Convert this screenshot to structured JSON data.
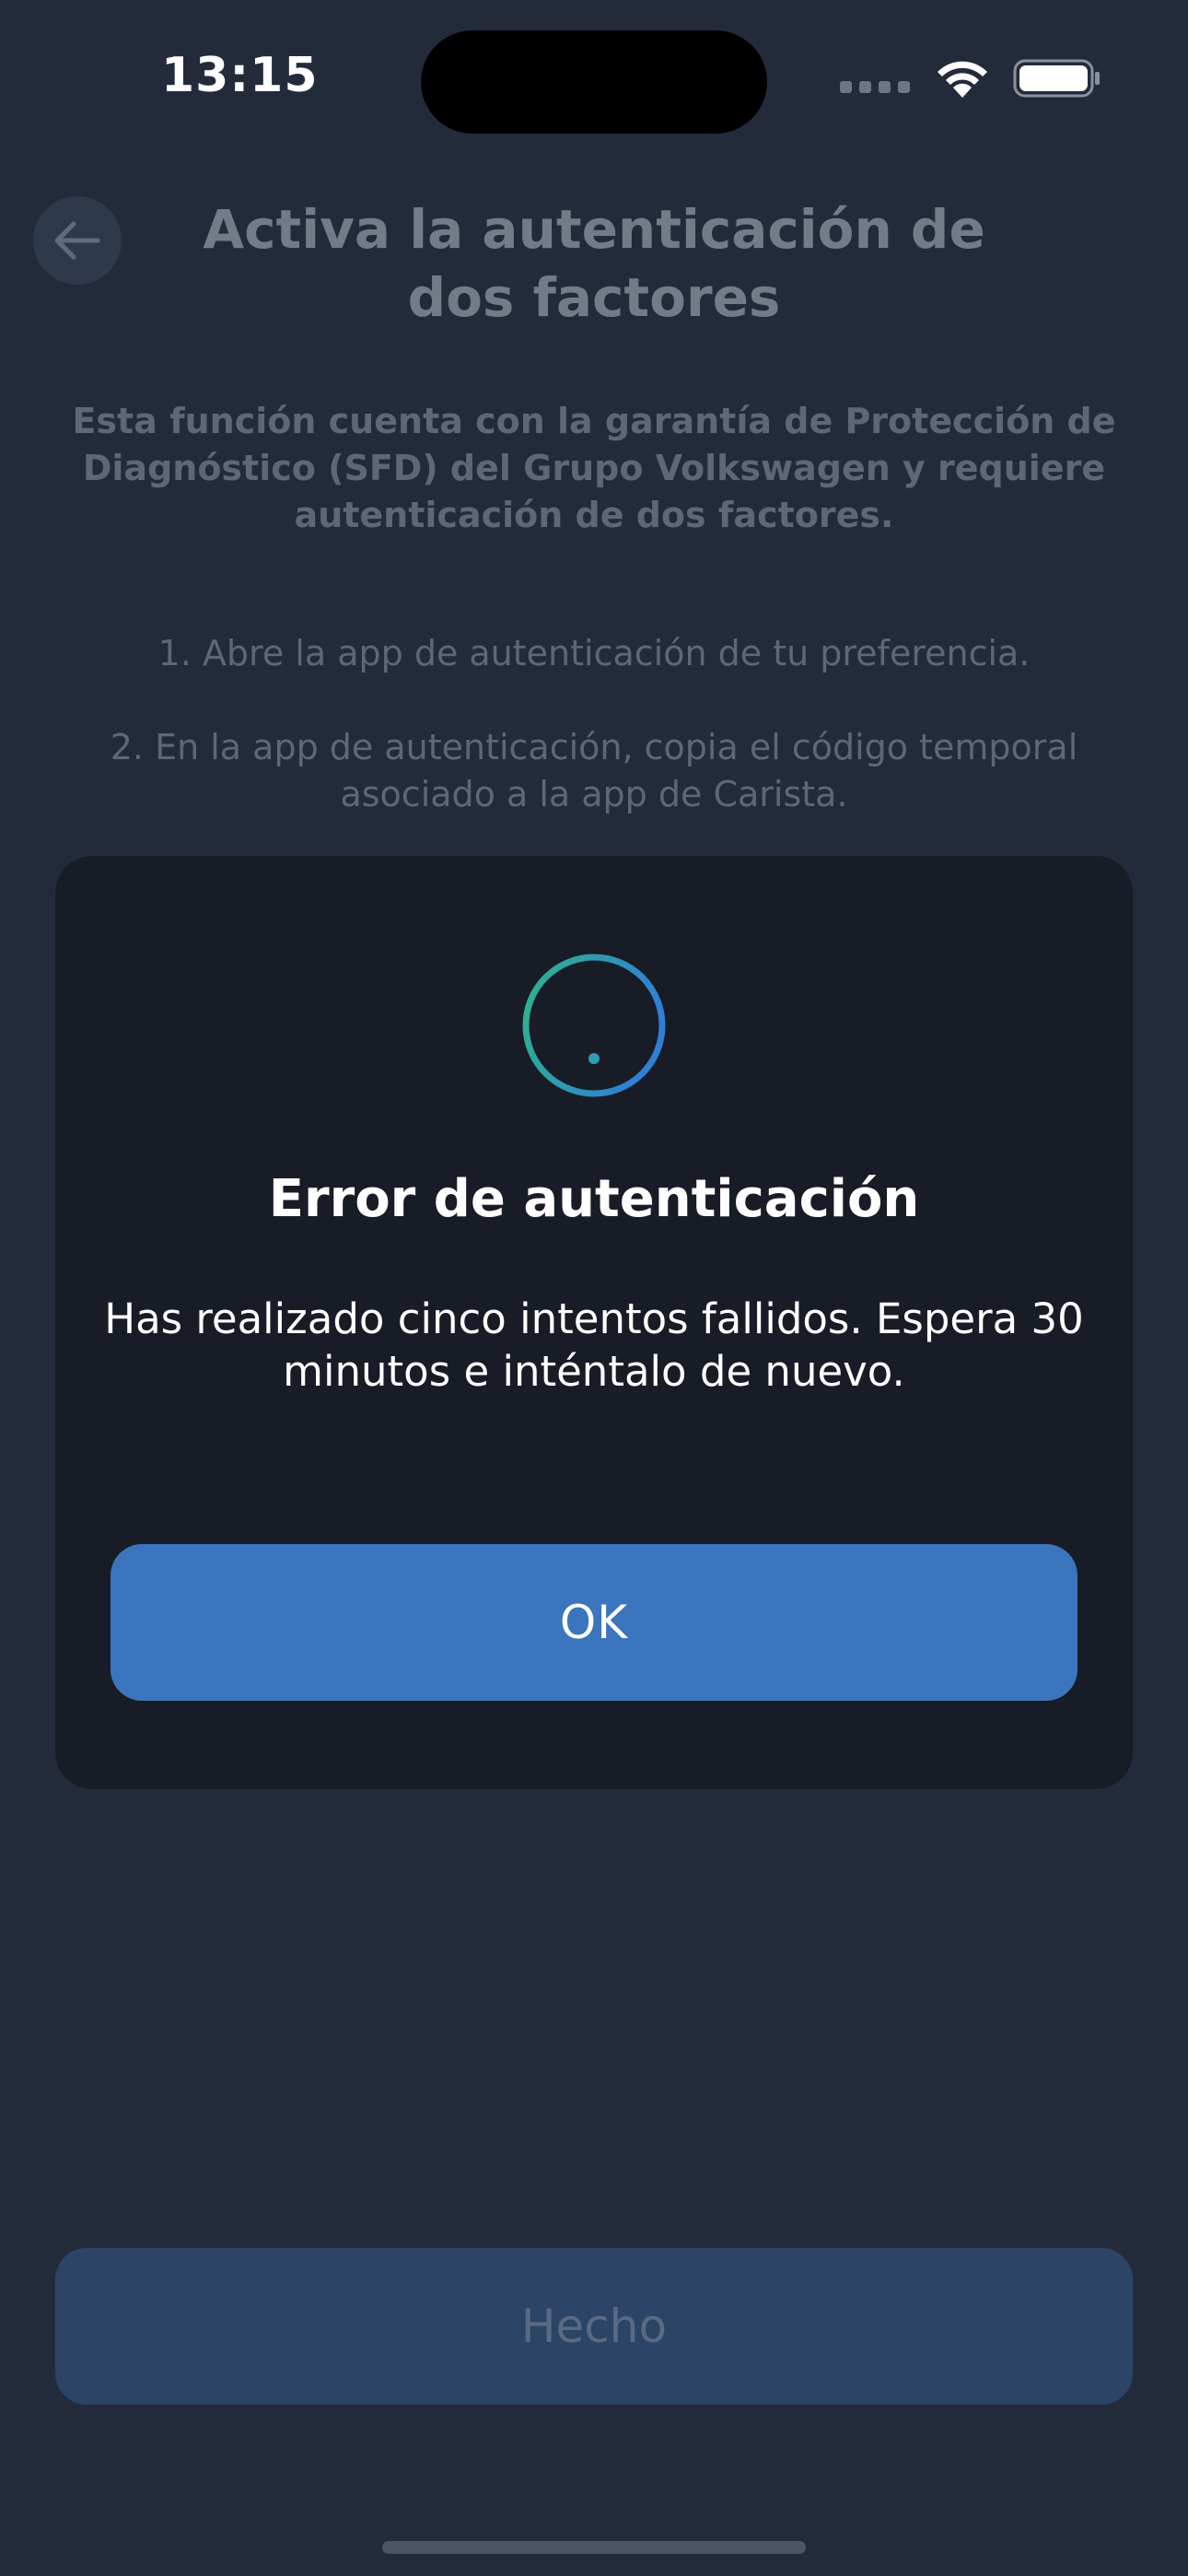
{
  "status_bar": {
    "time": "13:15"
  },
  "header": {
    "back_icon": "arrow-left-icon",
    "title": "Activa la autenticación de dos factores"
  },
  "content": {
    "subtitle": "Esta función cuenta con la garantía de Protección de Diagnóstico (SFD) del Grupo Volkswagen y requiere autenticación de dos factores.",
    "steps": [
      "1. Abre la app de autenticación de tu preferencia.",
      "2. En la app de autenticación, copia el código temporal asociado a la app de Carista."
    ]
  },
  "dialog": {
    "icon": "exclamation-circle-icon",
    "title": "Error de autenticación",
    "message": "Has realizado cinco intentos fallidos. Espera 30 minutos e inténtalo de nuevo.",
    "ok_label": "OK"
  },
  "footer": {
    "done_label": "Hecho"
  },
  "colors": {
    "background": "#232b3b",
    "dialog_background": "#181c27",
    "primary_button": "#3b75bd",
    "disabled_button": "#2c4466",
    "icon_gradient_start": "#2fb38a",
    "icon_gradient_end": "#2f7fd6"
  }
}
